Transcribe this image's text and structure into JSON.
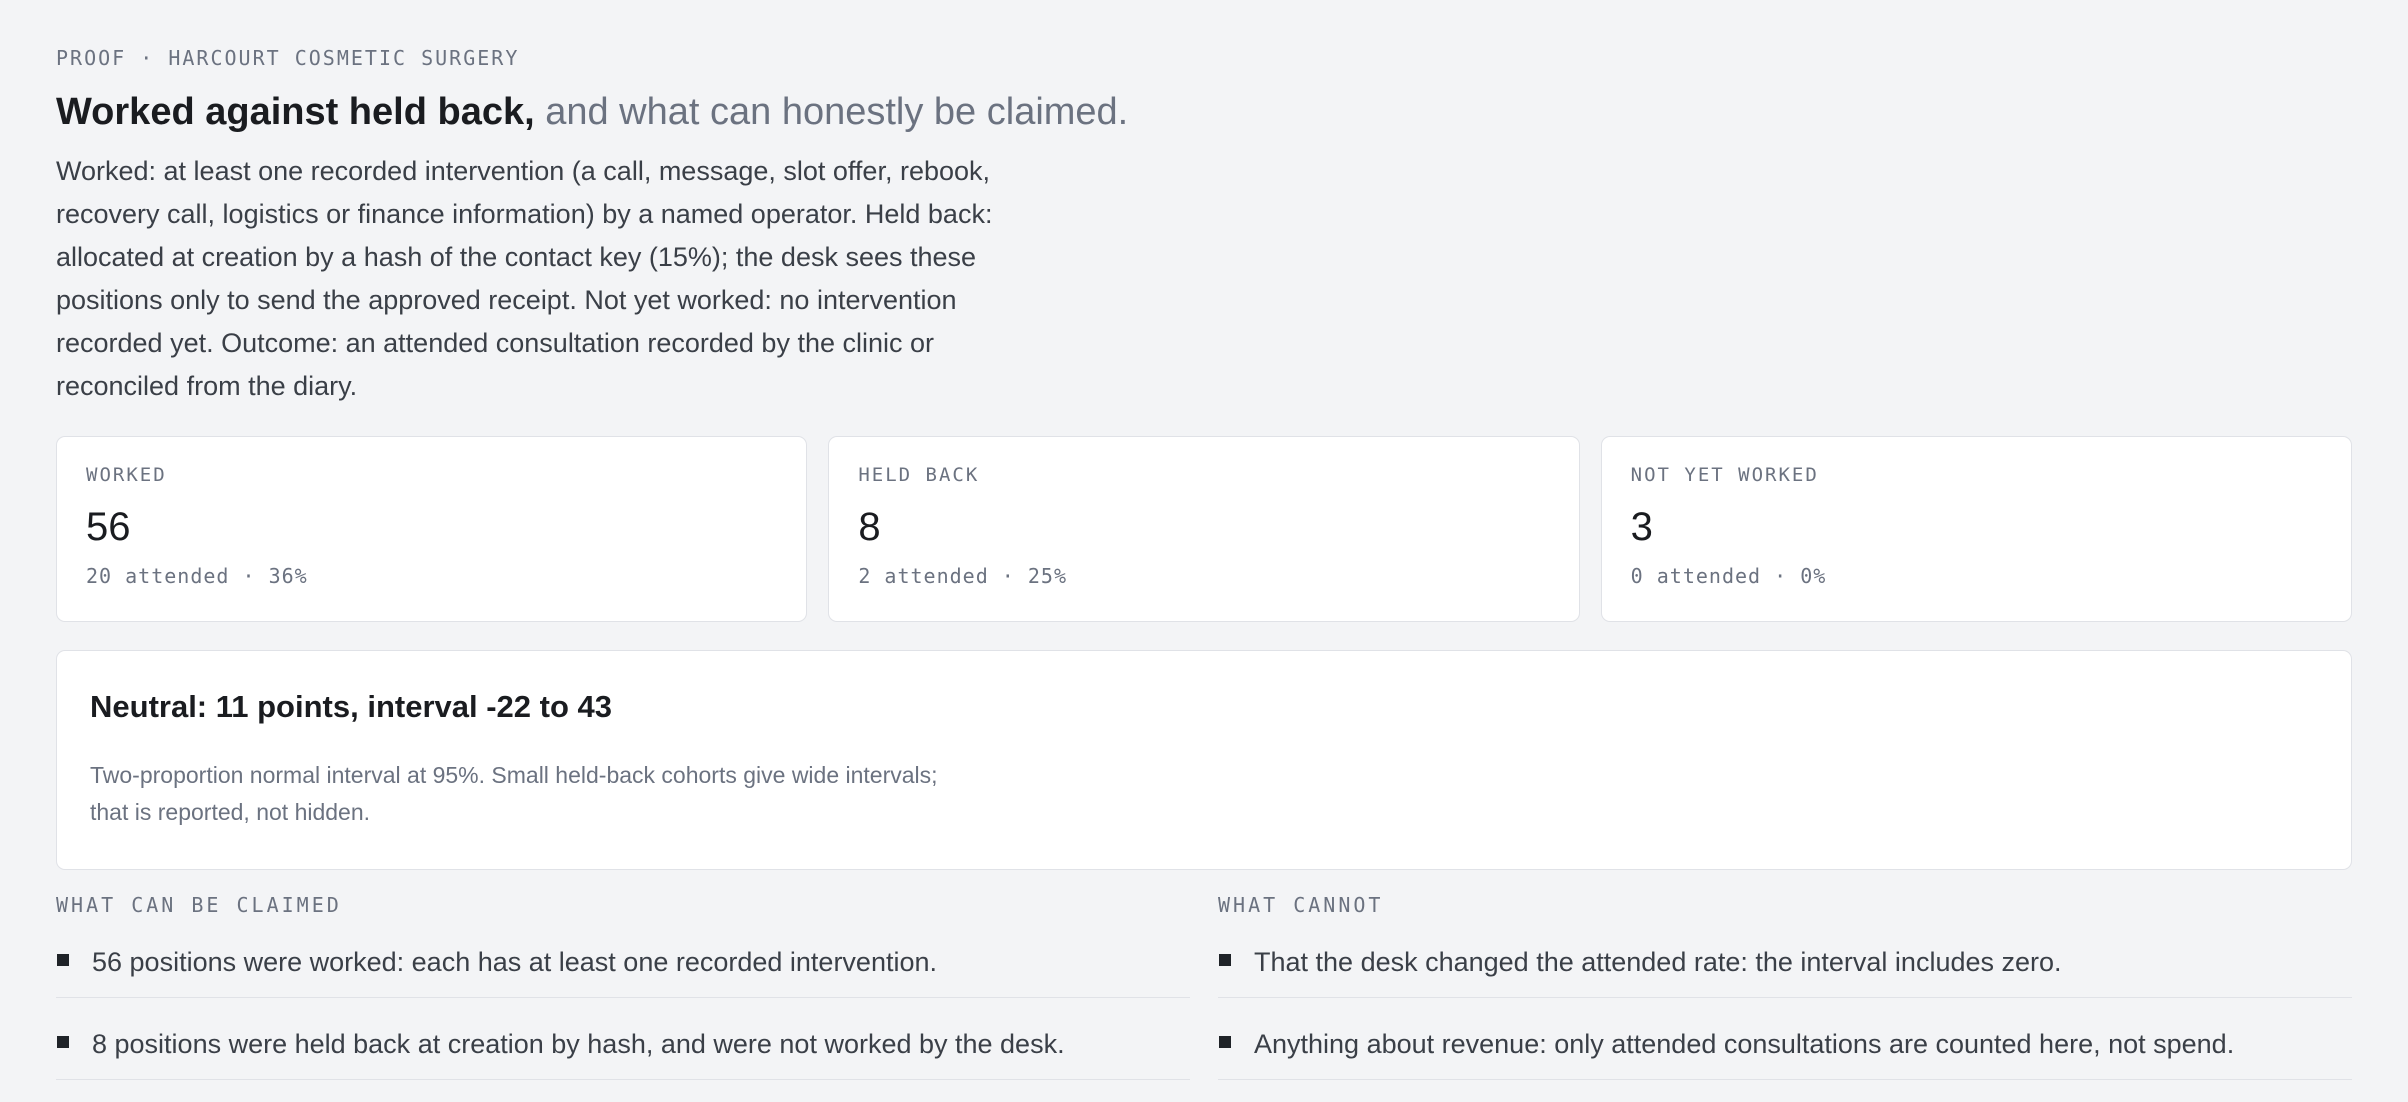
{
  "header": {
    "eyebrow": "PROOF · HARCOURT COSMETIC SURGERY",
    "title_strong": "Worked against held back,",
    "title_muted": "and what can honestly be claimed.",
    "intro": "Worked: at least one recorded intervention (a call, message, slot offer, rebook, recovery call, logistics or finance information) by a named operator. Held back: allocated at creation by a hash of the contact key (15%); the desk sees these positions only to send the approved receipt. Not yet worked: no intervention recorded yet. Outcome: an attended consultation recorded by the clinic or reconciled from the diary."
  },
  "stats": [
    {
      "label": "WORKED",
      "value": "56",
      "sub": "20 attended · 36%"
    },
    {
      "label": "HELD BACK",
      "value": "8",
      "sub": "2 attended · 25%"
    },
    {
      "label": "NOT YET WORKED",
      "value": "3",
      "sub": "0 attended · 0%"
    }
  ],
  "neutral": {
    "head": "Neutral: 11 points, interval -22 to 43",
    "note": "Two-proportion normal interval at 95%. Small held-back cohorts give wide intervals; that is reported, not hidden."
  },
  "claims": {
    "can_head": "WHAT CAN BE CLAIMED",
    "can_items": [
      "56 positions were worked: each has at least one recorded intervention.",
      "8 positions were held back at creation by hash, and were not worked by the desk."
    ],
    "cannot_head": "WHAT CANNOT",
    "cannot_items": [
      "That the desk changed the attended rate: the interval includes zero.",
      "Anything about revenue: only attended consultations are counted here, not spend."
    ]
  }
}
